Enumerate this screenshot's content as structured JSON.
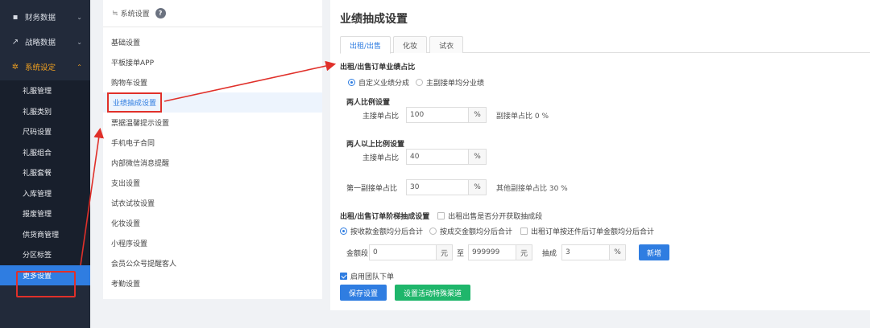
{
  "sidebar": {
    "groups": [
      {
        "icon": "briefcase-icon",
        "label": "财务数据"
      },
      {
        "icon": "trend-icon",
        "label": "战略数据"
      },
      {
        "icon": "gear-icon",
        "label": "系统设定"
      }
    ],
    "items": [
      "礼服管理",
      "礼服类别",
      "尺码设置",
      "礼服组合",
      "礼服套餐",
      "入库管理",
      "报废管理",
      "供货商管理",
      "分区标签",
      "更多设置"
    ],
    "selected": "更多设置"
  },
  "menu": {
    "header": "系统设置",
    "header_icon": "≒",
    "help_icon": "?",
    "items": [
      "基础设置",
      "平板接单APP",
      "购物车设置",
      "业绩抽成设置",
      "票据温馨提示设置",
      "手机电子合同",
      "内部微信消息提醒",
      "支出设置",
      "试衣试妆设置",
      "化妆设置",
      "小程序设置",
      "会员公众号提醒客人",
      "考勤设置"
    ],
    "active": "业绩抽成设置"
  },
  "content": {
    "title": "业绩抽成设置",
    "tabs": [
      "出租/出售",
      "化妆",
      "试衣"
    ],
    "active_tab": "出租/出售",
    "section1": {
      "title": "出租/出售订单业绩占比",
      "radio1": "自定义业绩分成",
      "radio2": "主副接单均分业绩",
      "two_person": {
        "title": "两人比例设置",
        "main_label": "主接单占比",
        "main_value": "100",
        "unit": "%",
        "note": "副接单占比 0 %"
      },
      "multi_person": {
        "title": "两人以上比例设置",
        "main_label": "主接单占比",
        "main_value": "40",
        "unit": "%",
        "first_label": "第一副接单占比",
        "first_value": "30",
        "note": "其他副接单占比 30 %"
      }
    },
    "section2": {
      "title": "出租/出售订单阶梯抽成设置",
      "checkbox_label": "出租出售是否分开获取抽成段",
      "radio1": "按收款金额均分后合计",
      "radio2": "按成交金额均分后合计",
      "checkbox2_label": "出租订单按还件后订单金额均分后合计",
      "range_label": "金额段",
      "from_value": "0",
      "yuan1": "元",
      "to_label": "至",
      "to_value": "999999",
      "yuan2": "元",
      "commission_label": "抽成",
      "commission_value": "3",
      "percent": "%",
      "add_button": "新增"
    },
    "team_checkbox": "启用团队下单",
    "save_button": "保存设置",
    "special_button": "设置活动特殊渠道"
  },
  "colors": {
    "accent": "#2f7de1",
    "highlight_red": "#e0302a",
    "sidebar_bg": "#222a3a",
    "active_orange": "#f0a020",
    "green": "#1fb66b"
  }
}
